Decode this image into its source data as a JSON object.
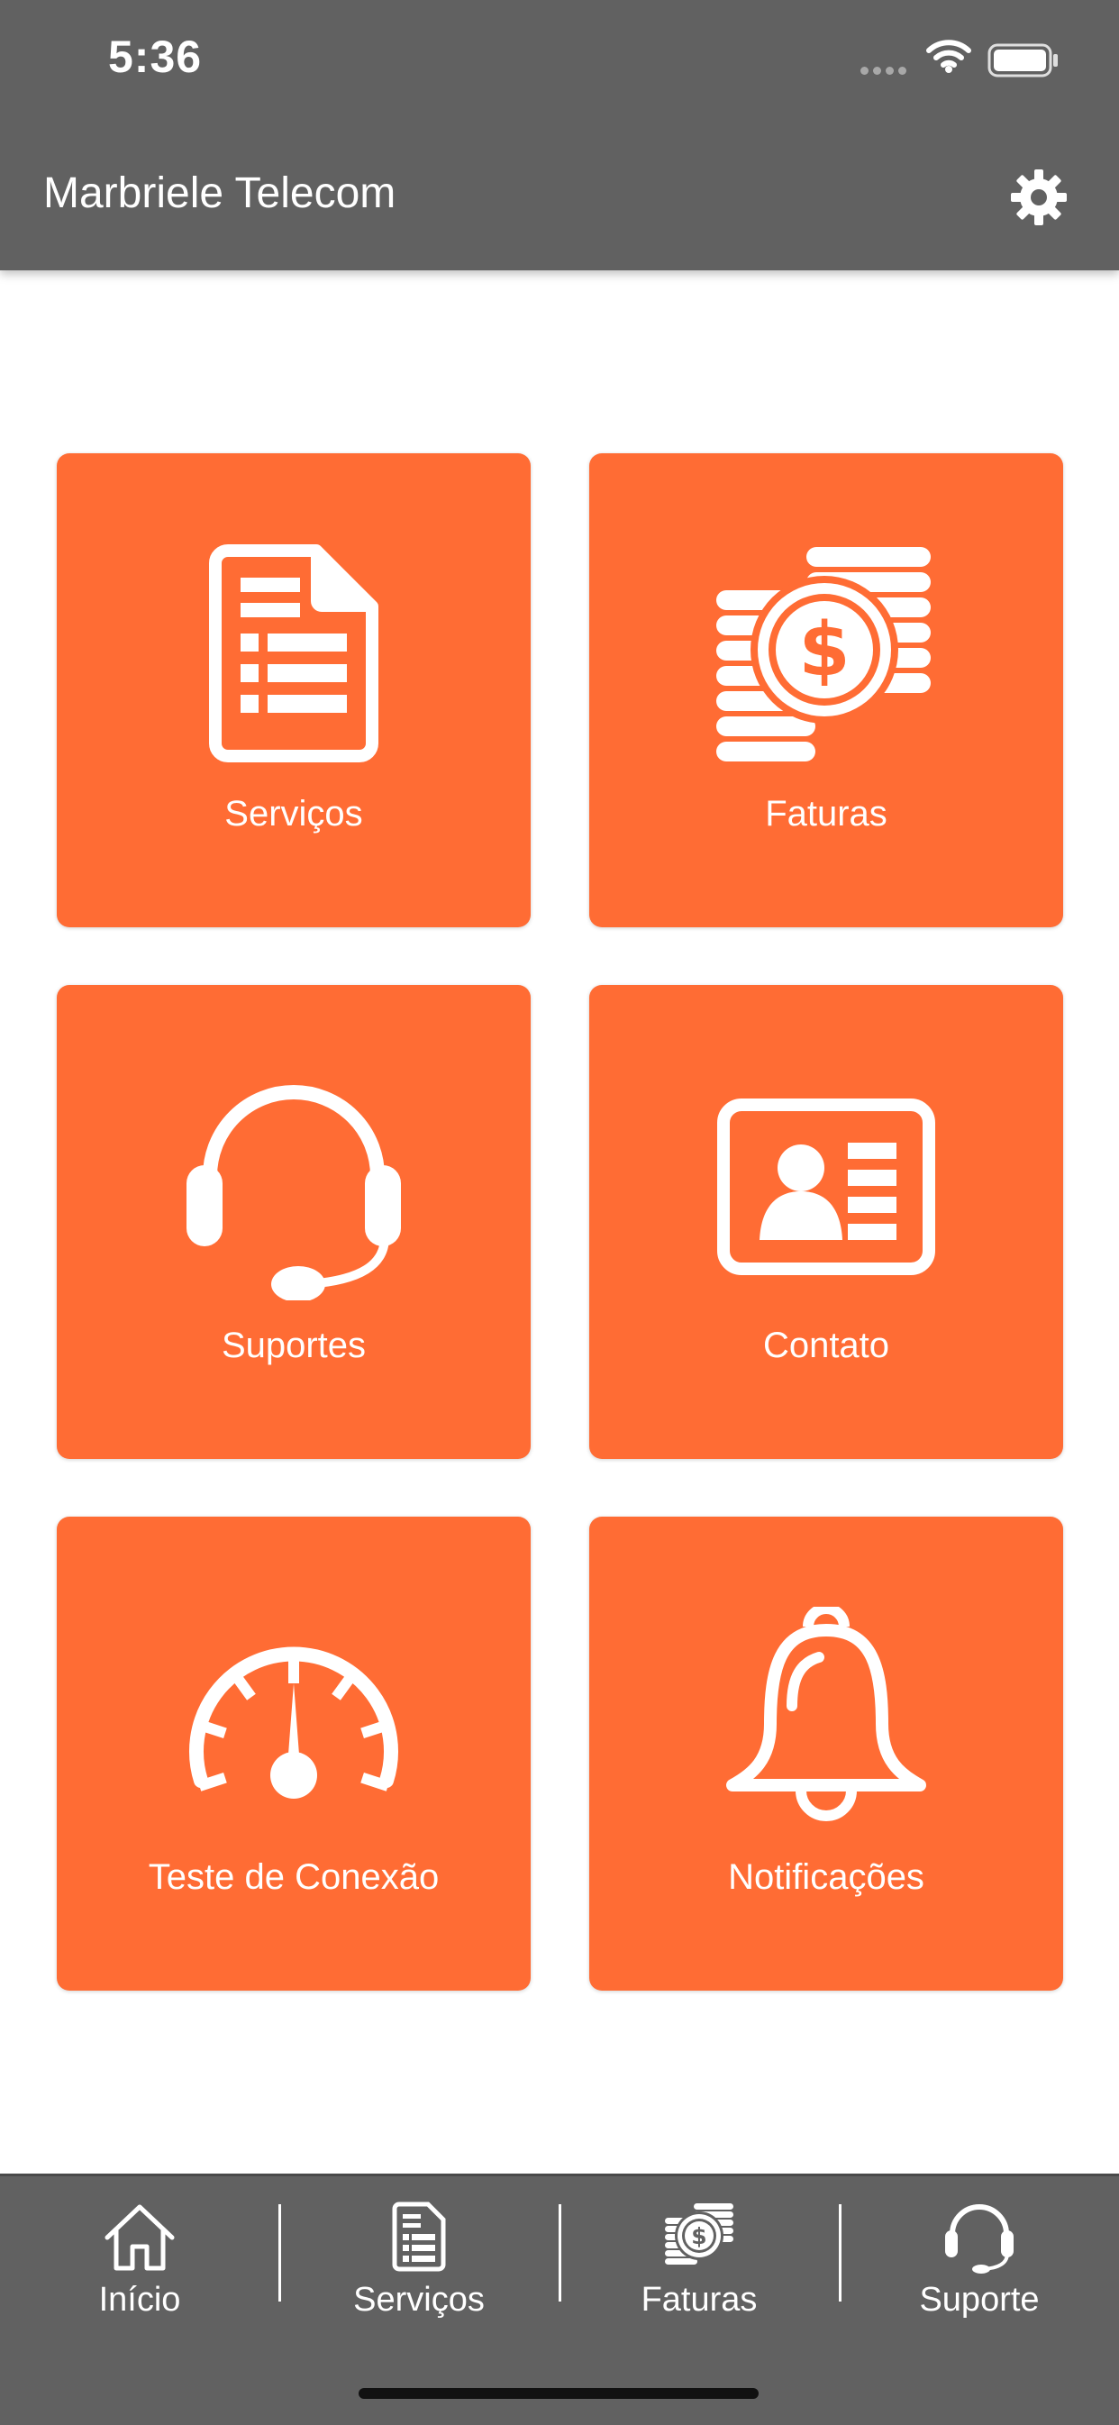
{
  "status_bar": {
    "time": "5:36"
  },
  "app_bar": {
    "title": "Marbriele Telecom",
    "settings_icon": "gear-icon"
  },
  "tiles": [
    {
      "label": "Serviços",
      "icon": "document-list-icon"
    },
    {
      "label": "Faturas",
      "icon": "coins-dollar-icon"
    },
    {
      "label": "Suportes",
      "icon": "headset-icon"
    },
    {
      "label": "Contato",
      "icon": "contact-card-icon"
    },
    {
      "label": "Teste de Conexão",
      "icon": "speedometer-icon"
    },
    {
      "label": "Notificações",
      "icon": "bell-icon"
    }
  ],
  "bottom_nav": [
    {
      "label": "Início",
      "icon": "home-icon"
    },
    {
      "label": "Serviços",
      "icon": "document-list-icon"
    },
    {
      "label": "Faturas",
      "icon": "coins-dollar-icon"
    },
    {
      "label": "Suporte",
      "icon": "headset-icon"
    }
  ],
  "colors": {
    "accent": "#ff6c34",
    "bar": "#616161",
    "text_on_accent": "#ffffff"
  }
}
